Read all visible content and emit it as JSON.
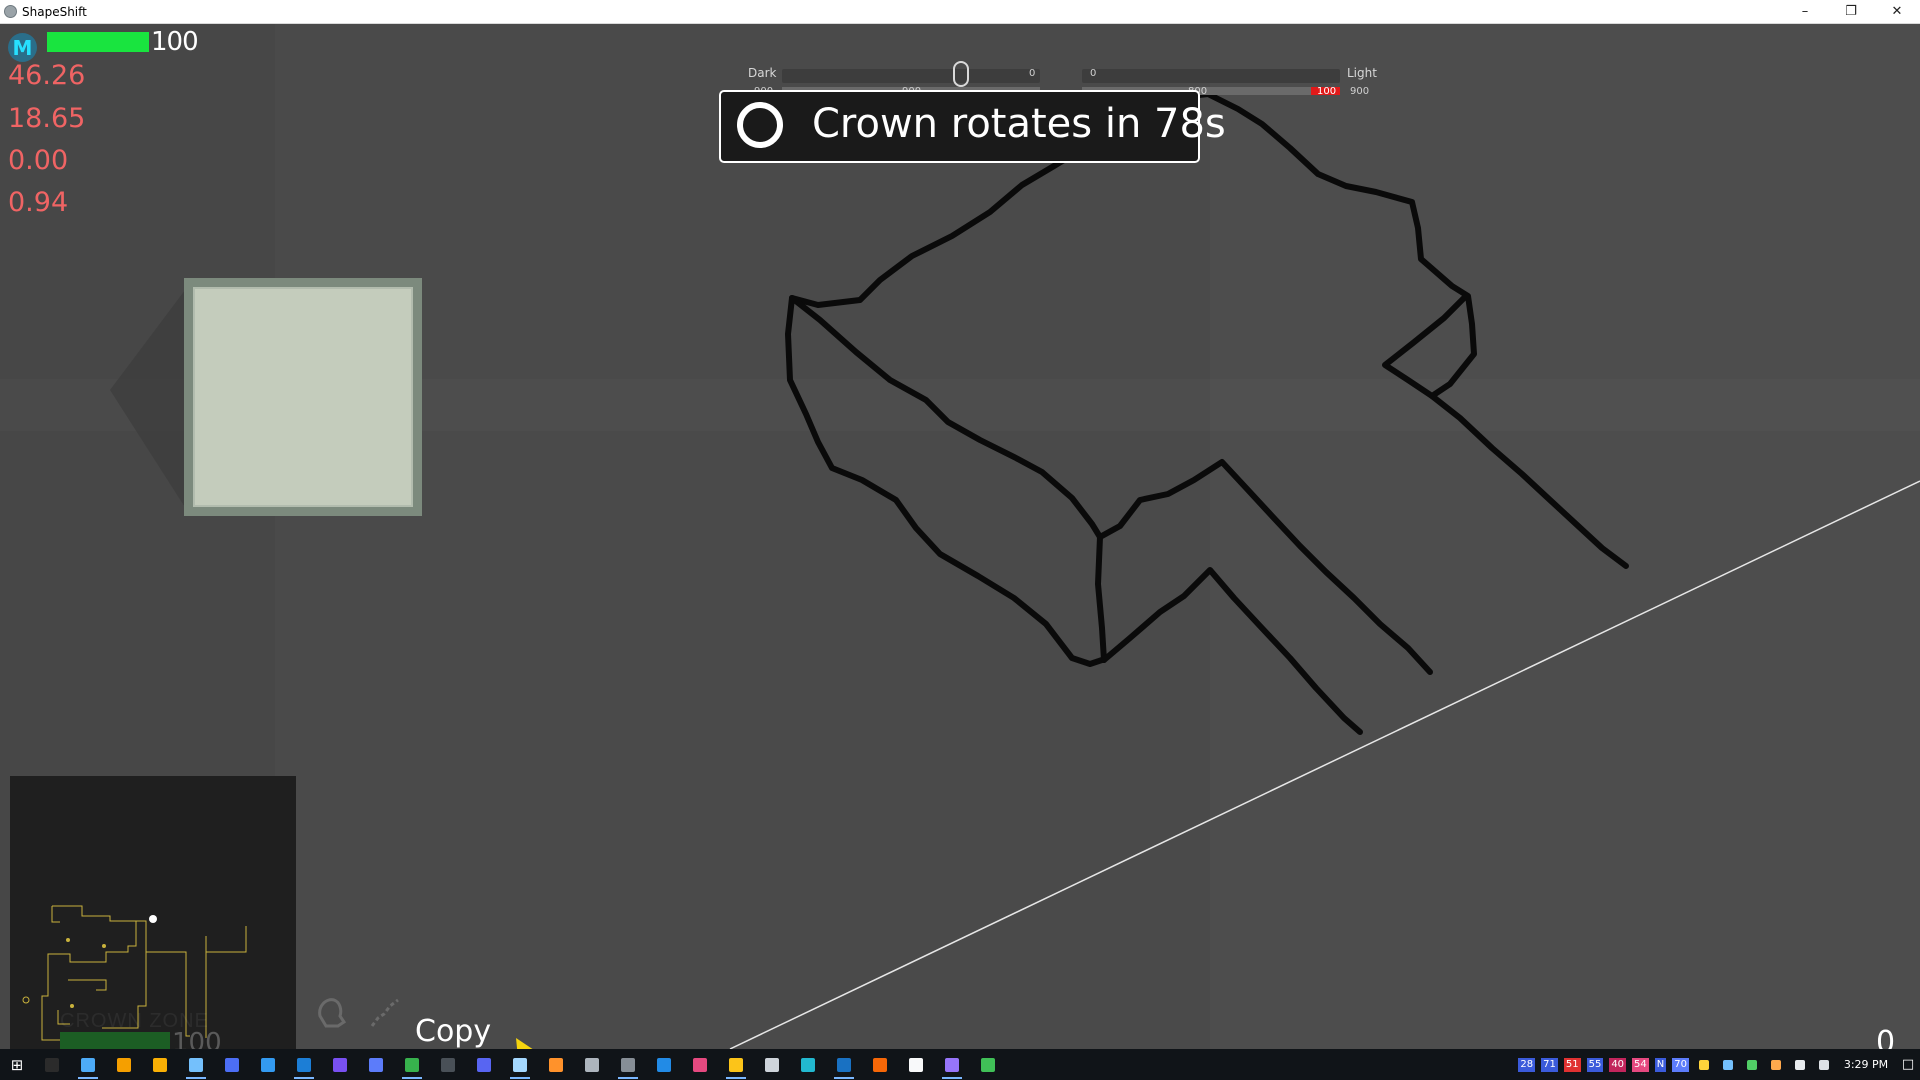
{
  "window": {
    "title": "ShapeShift",
    "controls": [
      "minimize-icon",
      "restore-icon",
      "close-icon"
    ]
  },
  "hud": {
    "logo_letter": "M",
    "health_value": "100",
    "health_fraction": 1.0,
    "stats": [
      "46.26",
      "18.65",
      "0.00",
      "0.94"
    ],
    "colors": {
      "health": "#19e43f",
      "stat": "#f06464",
      "logo": "#27e0ff"
    }
  },
  "slider": {
    "left_label": "Dark",
    "right_label": "Light",
    "left_value": "0",
    "right_value": "0",
    "sub_left_outer": "900",
    "sub_left_inner": "900",
    "sub_right_inner": "800",
    "sub_right_red": "100",
    "sub_right_outer": "900"
  },
  "timer": {
    "message": "Crown rotates in 78s",
    "icon": "ring-icon"
  },
  "minimap": {
    "zone_label": "CROWN ZONE",
    "health_value": "100"
  },
  "tools": {
    "icons": [
      "stamp-icon",
      "draw-icon"
    ],
    "action_label": "Copy",
    "cursor_icon": "arrow-cursor-icon"
  },
  "counter": "0",
  "taskbar": {
    "start_icon": "windows-start-icon",
    "apps": [
      "task-view-icon",
      "chrome-icon",
      "file-explorer-icon",
      "media-icon",
      "notepad-icon",
      "documents-icon",
      "edge-icon",
      "steam-icon",
      "visual-studio-icon",
      "vs-code-icon",
      "houdini-icon",
      "terminal-icon",
      "discord-icon",
      "browser-icon",
      "firefox-icon",
      "settings-icon",
      "app-icon",
      "photoshop-icon",
      "paint-icon",
      "chrome-canary-icon",
      "tool-icon",
      "vs-code-insiders-icon",
      "remote-desktop-icon",
      "git-icon",
      "up-arrow-icon",
      "visual-studio-preview-icon",
      "circle-icon"
    ],
    "tray_numbers": [
      "28",
      "71",
      "51",
      "55",
      "40",
      "54",
      "N",
      "70"
    ],
    "tray_colors": [
      "#3b5bdb",
      "#3b5bdb",
      "#e03131",
      "#3b5bdb",
      "#c2255c",
      "#e64980",
      "#3b5bdb",
      "#5c7cfa"
    ],
    "clock": "3:29 PM",
    "notifications_icon": "notifications-icon"
  }
}
